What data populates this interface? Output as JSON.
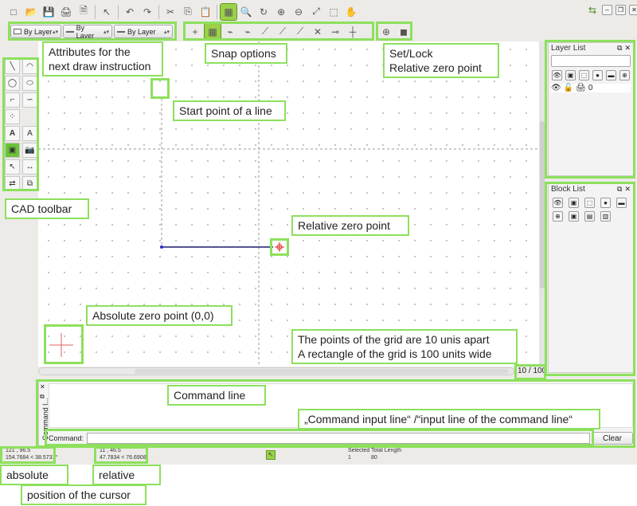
{
  "toolbar_top": {
    "icons": [
      "new-file-icon",
      "open-file-icon",
      "save-icon",
      "print-icon",
      "print-preview-icon",
      "pointer-icon",
      "undo-icon",
      "redo-icon",
      "cut-icon",
      "copy-icon",
      "paste-icon",
      "grid-icon",
      "zoom-icon",
      "redraw-icon",
      "zoom-in-icon",
      "zoom-out-icon",
      "zoom-auto-icon",
      "zoom-window-icon",
      "pan-icon"
    ],
    "glyphs": [
      "□",
      "📂",
      "💾",
      "🖨",
      "🗎",
      "↖",
      "↶",
      "↷",
      "✂",
      "⎘",
      "📋",
      "▦",
      "🔍",
      "↻",
      "⊕",
      "⊖",
      "⤢",
      "⬚",
      "✋"
    ]
  },
  "attributes": {
    "pen": "By Layer",
    "width": "By Layer",
    "type": "By Layer"
  },
  "snap_glyphs": [
    "+",
    "▦",
    "⌁",
    "⌁",
    "⟋",
    "⟋",
    "⟋",
    "✕",
    "⊸",
    "┼"
  ],
  "relzero_glyphs": [
    "⊕",
    "◼"
  ],
  "layer_list": {
    "title": "Layer List",
    "layer_name": "0",
    "icons": [
      "👁",
      "▣",
      "⬚",
      "●",
      "▬",
      "⊕"
    ]
  },
  "block_list": {
    "title": "Block List",
    "icons": [
      "👁",
      "▣",
      "⬚",
      "●",
      "▬",
      "⊕",
      "▣",
      "▤",
      "▥"
    ]
  },
  "scroll_page": "10 / 100",
  "command": {
    "dock_label": "Command l...",
    "prompt": "Command:",
    "clear": "Clear"
  },
  "status": {
    "abs_line1": "121 , 96.5",
    "abs_line2": "154.7684 < 38.5731°",
    "rel_line1": "11 , 46.5",
    "rel_line2": "47.7834 < 76.6908°",
    "selected_label": "Selected",
    "selected_value": "1",
    "total_label": "Total Length",
    "total_value": "80"
  },
  "callouts": {
    "attributes": "Attributes for the\nnext draw instruction",
    "snap": "Snap options",
    "setlock": "Set/Lock\nRelative zero point",
    "start": "Start point of a line",
    "cad_toolbar": "CAD toolbar",
    "relzero": "Relative zero point",
    "abszero": "Absolute zero point (0,0)",
    "grid": "The points of the grid are 10 unis apart\nA rectangle of the grid is 100 units wide",
    "command_line": "Command line",
    "input_line": "„Command input line“ /“input line of the command line“",
    "absolute": "absolute",
    "relative": "relative",
    "cursor": "position of the cursor"
  },
  "colors": {
    "highlight": "#8de05d",
    "active": "#9bd04a",
    "line": "#1a1a6a",
    "marker": "#e02020"
  }
}
